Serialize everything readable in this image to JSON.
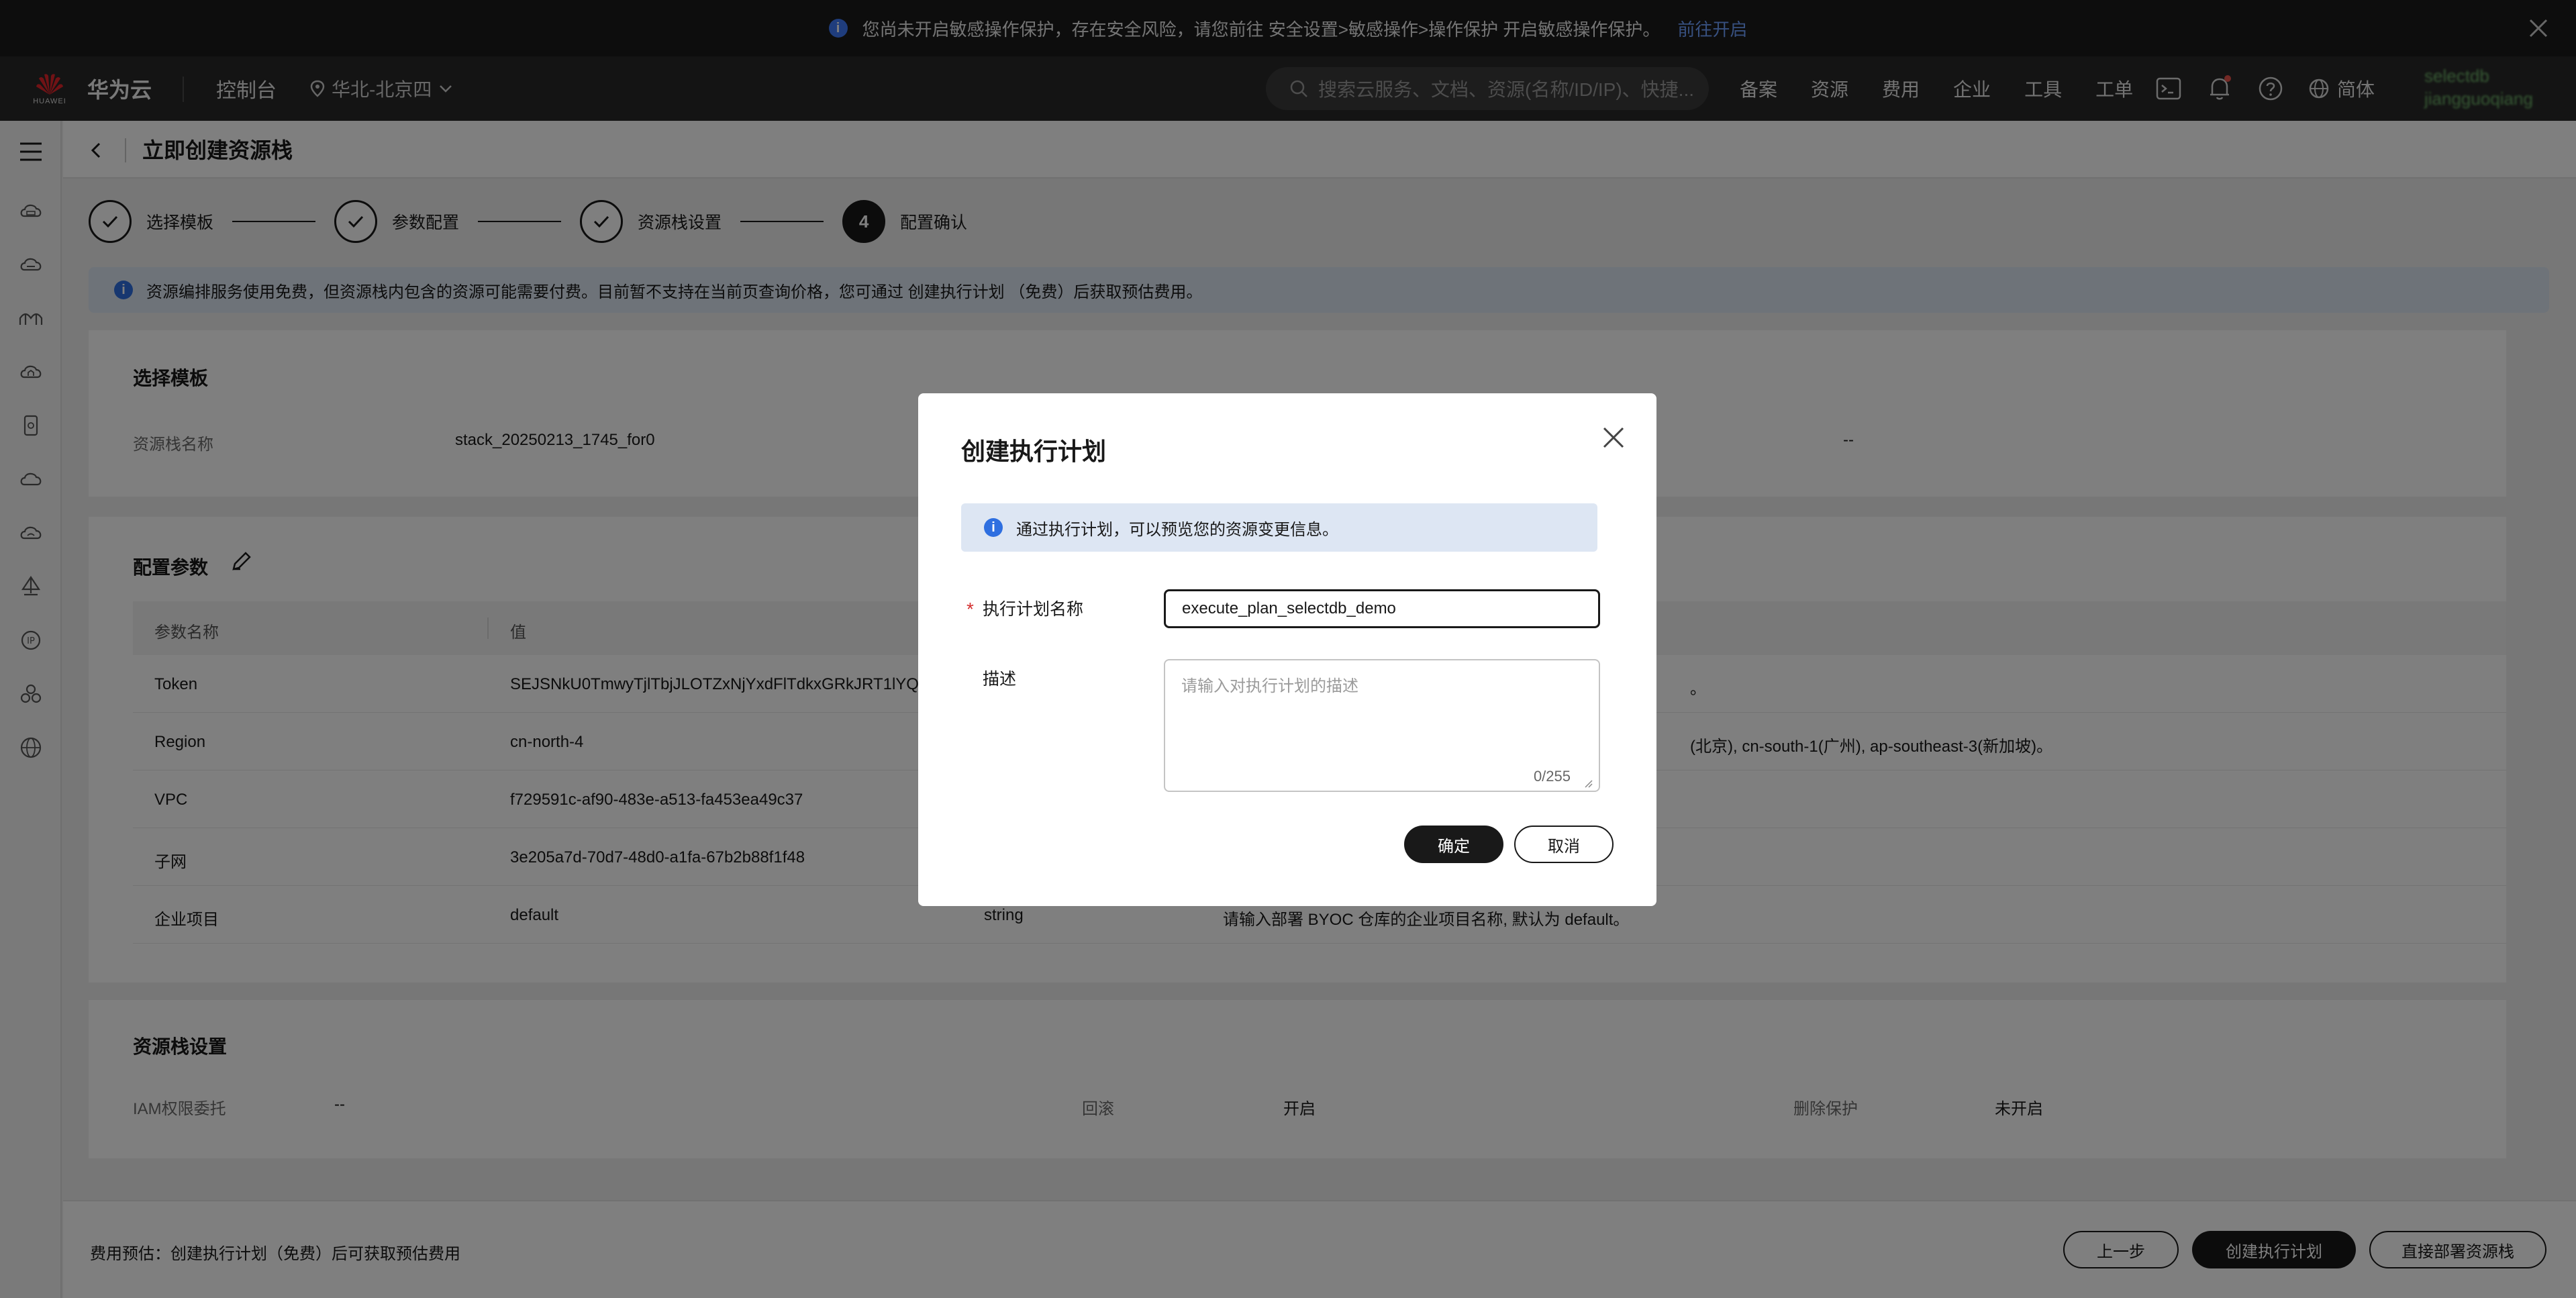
{
  "notice": {
    "text": "您尚未开启敏感操作保护，存在安全风险，请您前往 安全设置>敏感操作>操作保护 开启敏感操作保护。",
    "link": "前往开启"
  },
  "header": {
    "logo_text": "HUAWEI",
    "brand": "华为云",
    "console": "控制台",
    "region": "华北-北京四",
    "search_placeholder": "搜索云服务、文档、资源(名称/ID/IP)、快捷...",
    "nav": [
      "备案",
      "资源",
      "费用",
      "企业",
      "工具",
      "工单"
    ],
    "lang": "简体",
    "user_line1": "selectdb",
    "user_line2": "jiangguoqiang"
  },
  "page": {
    "title": "立即创建资源栈"
  },
  "steps": [
    {
      "label": "选择模板",
      "state": "done"
    },
    {
      "label": "参数配置",
      "state": "done"
    },
    {
      "label": "资源栈设置",
      "state": "done"
    },
    {
      "label": "配置确认",
      "state": "active",
      "number": "4"
    }
  ],
  "info_bar": "资源编排服务使用免费，但资源栈内包含的资源可能需要付费。目前暂不支持在当前页查询价格，您可通过 创建执行计划 （免费）后获取预估费用。",
  "template_section": {
    "heading": "选择模板",
    "stack_name_label": "资源栈名称",
    "stack_name_value": "stack_20250213_1745_for0",
    "extra_value": "--"
  },
  "params_section": {
    "heading": "配置参数",
    "col_name": "参数名称",
    "col_value": "值",
    "rows": [
      {
        "name": "Token",
        "value": "SEJSNkU0TmwyTjlTbjJLOTZxNjYxdFlTdkxGRkJRT1lYQ",
        "type": "",
        "desc": "。"
      },
      {
        "name": "Region",
        "value": "cn-north-4",
        "type": "",
        "desc": "(北京), cn-south-1(广州), ap-southeast-3(新加坡)。"
      },
      {
        "name": "VPC",
        "value": "f729591c-af90-483e-a513-fa453ea49c37",
        "type": "",
        "desc": ""
      },
      {
        "name": "子网",
        "value": "3e205a7d-70d7-48d0-a1fa-67b2b88f1f48",
        "type": "",
        "desc": ""
      },
      {
        "name": "企业项目",
        "value": "default",
        "type": "string",
        "desc": "请输入部署 BYOC 仓库的企业项目名称, 默认为 default。"
      }
    ]
  },
  "stack_settings": {
    "heading": "资源栈设置",
    "iam_label": "IAM权限委托",
    "iam_value": "--",
    "rollback_label": "回滚",
    "rollback_value": "开启",
    "delete_label": "删除保护",
    "delete_value": "未开启"
  },
  "modal": {
    "title": "创建执行计划",
    "info": "通过执行计划，可以预览您的资源变更信息。",
    "name_label": "执行计划名称",
    "name_value": "execute_plan_selectdb_demo",
    "desc_label": "描述",
    "desc_placeholder": "请输入对执行计划的描述",
    "desc_count": "0/255",
    "confirm": "确定",
    "cancel": "取消"
  },
  "footer": {
    "fee": "费用预估：创建执行计划（免费）后可获取预估费用",
    "prev": "上一步",
    "create_plan": "创建执行计划",
    "deploy": "直接部署资源栈"
  }
}
